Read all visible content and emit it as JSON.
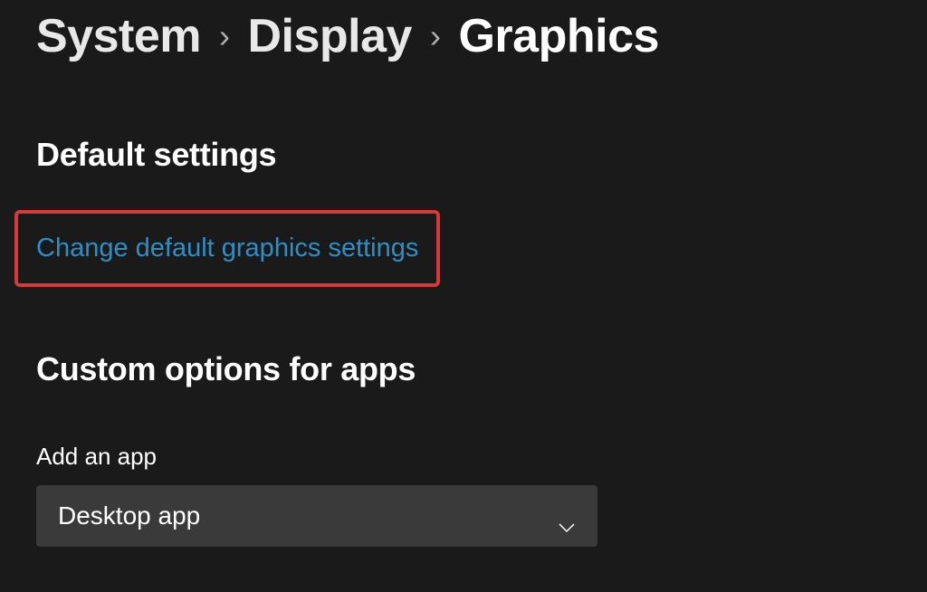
{
  "breadcrumb": {
    "items": [
      {
        "label": "System"
      },
      {
        "label": "Display"
      },
      {
        "label": "Graphics",
        "current": true
      }
    ]
  },
  "sections": {
    "default_settings": {
      "heading": "Default settings",
      "link_label": "Change default graphics settings"
    },
    "custom_options": {
      "heading": "Custom options for apps",
      "add_app_label": "Add an app",
      "dropdown_selected": "Desktop app"
    }
  }
}
